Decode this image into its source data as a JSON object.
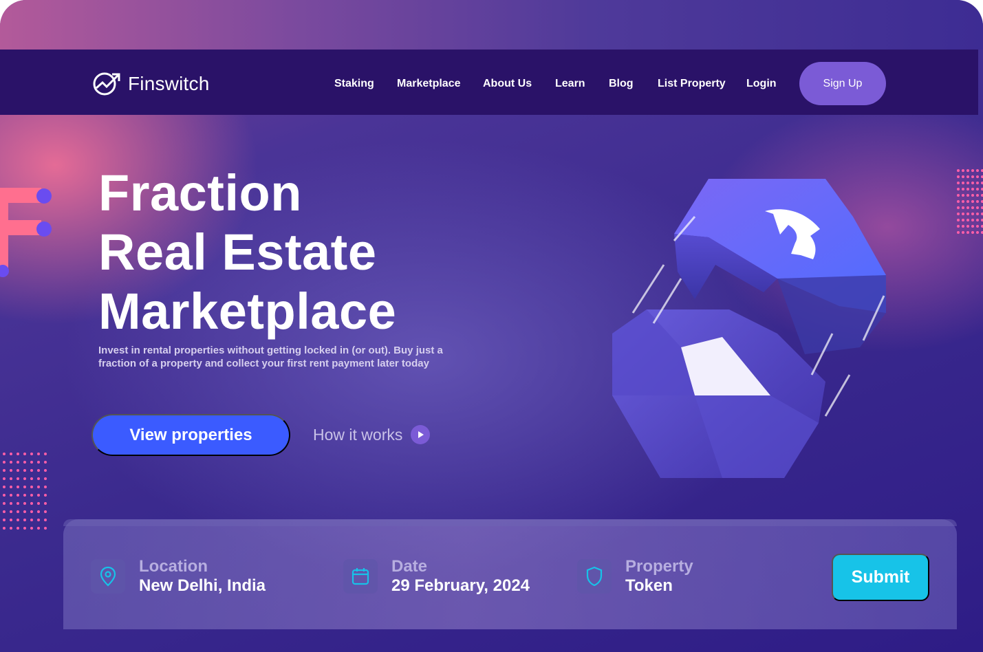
{
  "brand": {
    "name": "Finswitch",
    "accent": "#7b5bd6",
    "nav_bg": "#2a1268"
  },
  "nav": {
    "items": [
      {
        "label": "Staking"
      },
      {
        "label": "Marketplace"
      },
      {
        "label": "About Us"
      },
      {
        "label": "Learn"
      },
      {
        "label": "Blog"
      },
      {
        "label": "List Property"
      },
      {
        "label": "Login"
      }
    ],
    "signup_label": "Sign Up"
  },
  "hero": {
    "title_lines": [
      "Fraction",
      "Real Estate",
      "Marketplace"
    ],
    "subtitle": "Invest in rental properties without getting locked in (or out). Buy just a fraction of a property and collect your first rent payment later today",
    "primary_cta": "View properties",
    "secondary_cta": "How it works",
    "primary_color": "#3b5bff"
  },
  "search": {
    "location": {
      "label": "Location",
      "value": "New Delhi, India",
      "icon": "location-pin-icon"
    },
    "date": {
      "label": "Date",
      "value": "29 February, 2024",
      "icon": "calendar-icon"
    },
    "property": {
      "label": "Property",
      "value": "Token",
      "icon": "shield-icon"
    },
    "submit_label": "Submit",
    "submit_color": "#17c3e8"
  }
}
